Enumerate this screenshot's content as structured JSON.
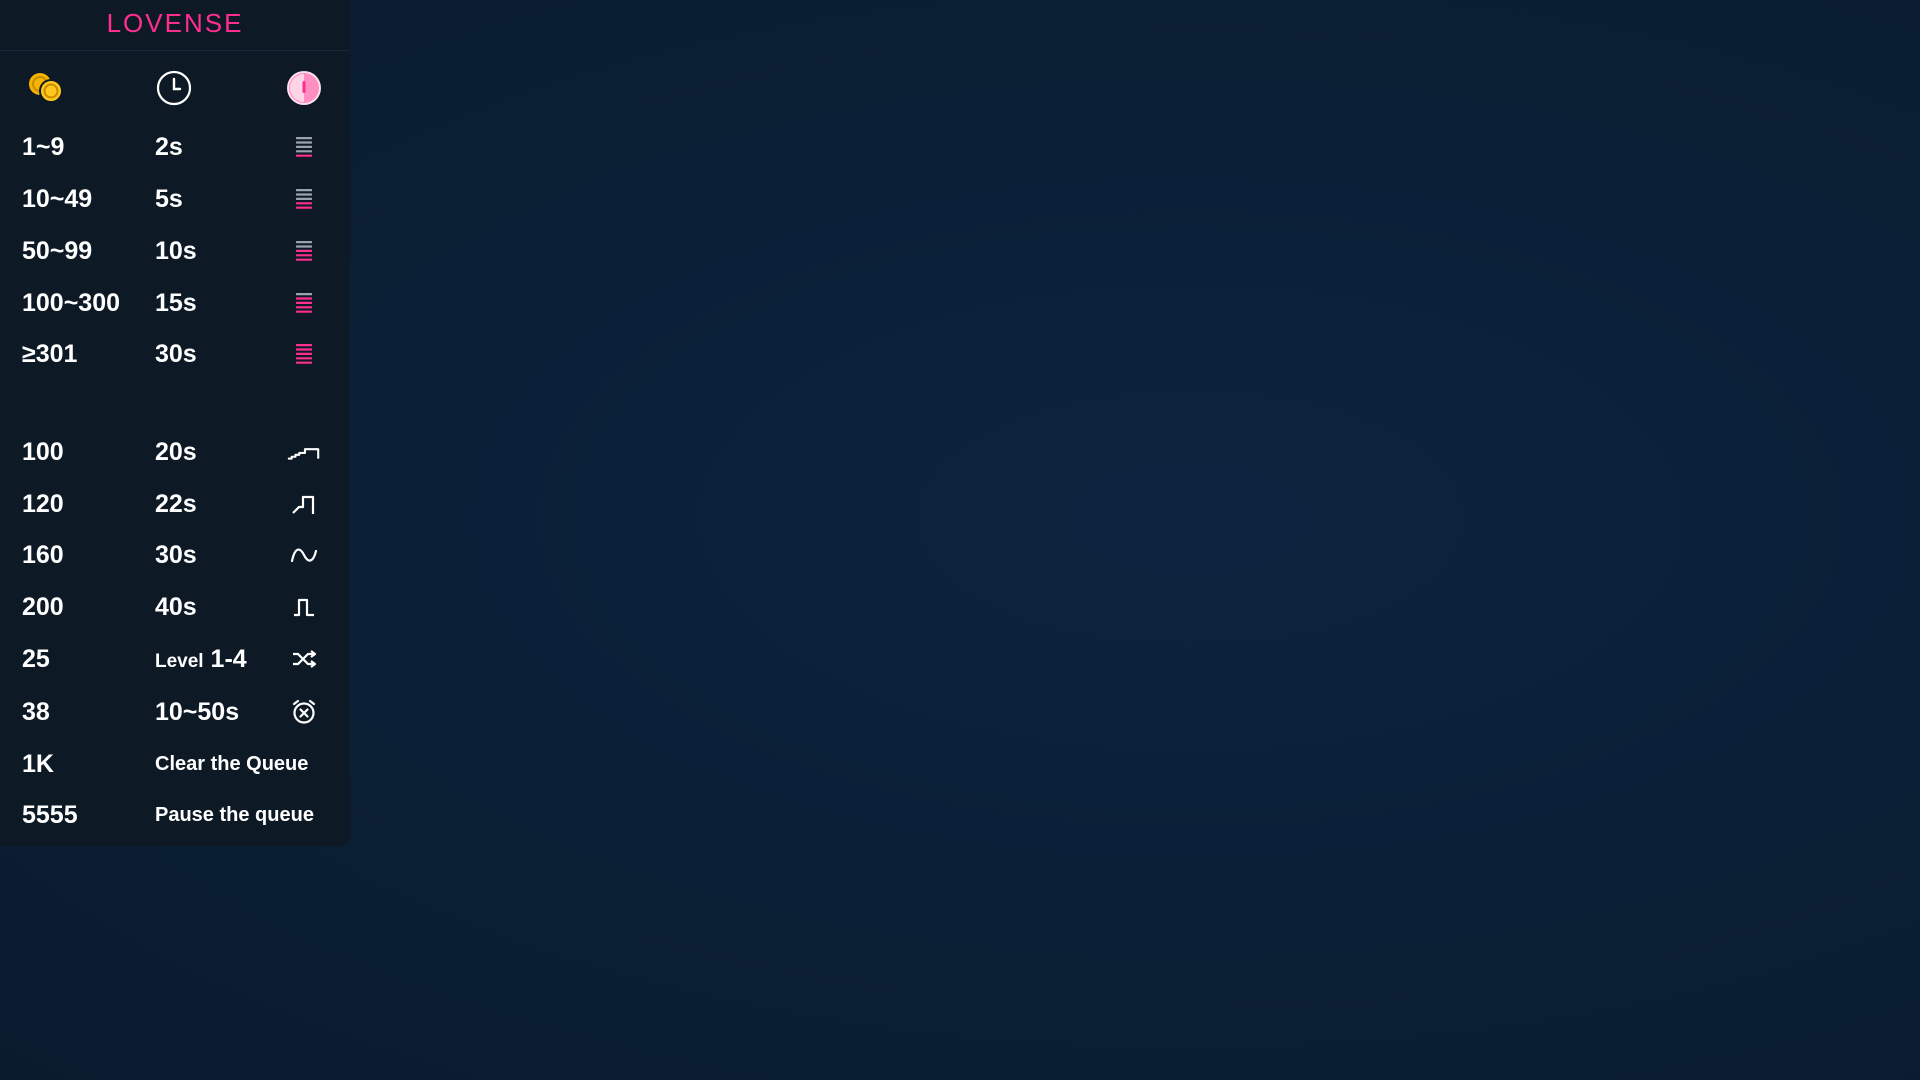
{
  "brand": "LOVENSE",
  "header_icons": {
    "col1": "coins-icon",
    "col2": "clock-icon",
    "col3": "vibration-level-icon"
  },
  "levels": [
    {
      "tokens": "1~9",
      "duration": "2s",
      "icon": "level-bars-icon",
      "bars_active": 1
    },
    {
      "tokens": "10~49",
      "duration": "5s",
      "icon": "level-bars-icon",
      "bars_active": 2
    },
    {
      "tokens": "50~99",
      "duration": "10s",
      "icon": "level-bars-icon",
      "bars_active": 3
    },
    {
      "tokens": "100~300",
      "duration": "15s",
      "icon": "level-bars-icon",
      "bars_active": 4
    },
    {
      "tokens": "≥301",
      "duration": "30s",
      "icon": "level-bars-icon",
      "bars_active": 5
    }
  ],
  "patterns": [
    {
      "tokens": "100",
      "duration": "20s",
      "icon": "wave-pattern-icon"
    },
    {
      "tokens": "120",
      "duration": "22s",
      "icon": "pulse-pattern-icon"
    },
    {
      "tokens": "160",
      "duration": "30s",
      "icon": "sine-wave-icon"
    },
    {
      "tokens": "200",
      "duration": "40s",
      "icon": "square-pulse-icon"
    }
  ],
  "specials": [
    {
      "tokens": "25",
      "duration_prefix": "Level",
      "duration_value": "1-4",
      "icon": "shuffle-icon"
    },
    {
      "tokens": "38",
      "duration": "10~50s",
      "icon": "alarm-clock-icon"
    },
    {
      "tokens": "1K",
      "action": "Clear the Queue"
    },
    {
      "tokens": "5555",
      "action": "Pause the queue"
    }
  ],
  "colors": {
    "accent": "#ff2d8f",
    "panel": "#0d1a26",
    "background": "#0b2037",
    "coin": "#f5b400",
    "bar_inactive": "#9aa3ad"
  }
}
